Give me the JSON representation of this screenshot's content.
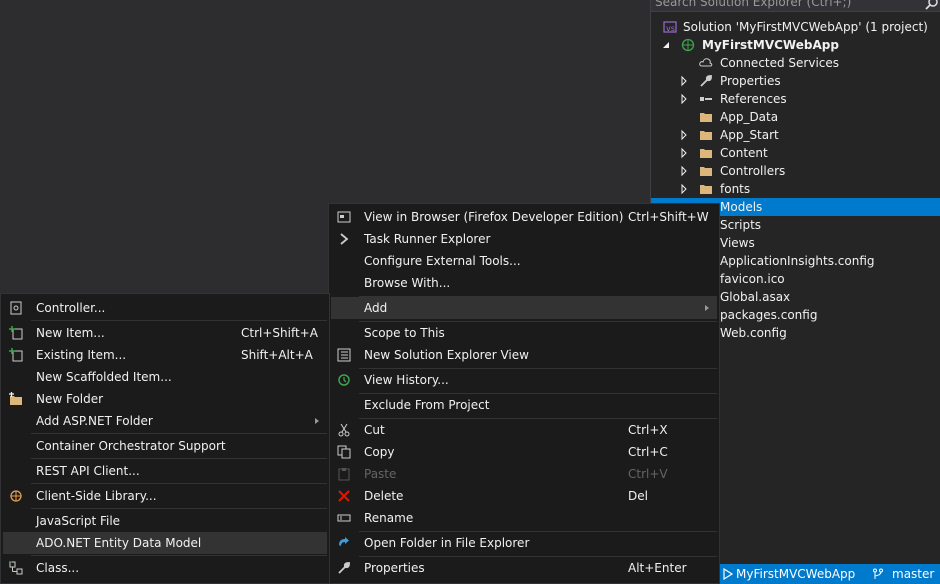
{
  "solution_explorer": {
    "search_placeholder": "Search Solution Explorer (Ctrl+;)",
    "solution_label": "Solution 'MyFirstMVCWebApp' (1 project)",
    "project_label": "MyFirstMVCWebApp",
    "items": [
      {
        "label": "Connected Services",
        "icon": "cloud-icon"
      },
      {
        "label": "Properties",
        "icon": "wrench-icon"
      },
      {
        "label": "References",
        "icon": "references-icon"
      },
      {
        "label": "App_Data",
        "icon": "folder-icon"
      },
      {
        "label": "App_Start",
        "icon": "folder-icon"
      },
      {
        "label": "Content",
        "icon": "folder-icon"
      },
      {
        "label": "Controllers",
        "icon": "folder-icon"
      },
      {
        "label": "fonts",
        "icon": "folder-icon"
      },
      {
        "label": "Models",
        "icon": "folder-icon"
      },
      {
        "label": "Scripts",
        "icon": "folder-icon"
      },
      {
        "label": "Views",
        "icon": "folder-icon"
      },
      {
        "label": "ApplicationInsights.config",
        "icon": "config-file-icon"
      },
      {
        "label": "favicon.ico",
        "icon": "ico-file-icon"
      },
      {
        "label": "Global.asax",
        "icon": "asax-file-icon"
      },
      {
        "label": "packages.config",
        "icon": "config-file-icon"
      },
      {
        "label": "Web.config",
        "icon": "config-file-icon"
      }
    ]
  },
  "context_menu": {
    "view_in_browser": {
      "label": "View in Browser (Firefox Developer Edition)",
      "shortcut": "Ctrl+Shift+W"
    },
    "task_runner": {
      "label": "Task Runner Explorer"
    },
    "configure_tools": {
      "label": "Configure External Tools..."
    },
    "browse_with": {
      "label": "Browse With..."
    },
    "add": {
      "label": "Add"
    },
    "scope_to_this": {
      "label": "Scope to This"
    },
    "new_se_view": {
      "label": "New Solution Explorer View"
    },
    "view_history": {
      "label": "View History..."
    },
    "exclude": {
      "label": "Exclude From Project"
    },
    "cut": {
      "label": "Cut",
      "shortcut": "Ctrl+X"
    },
    "copy": {
      "label": "Copy",
      "shortcut": "Ctrl+C"
    },
    "paste": {
      "label": "Paste",
      "shortcut": "Ctrl+V"
    },
    "delete": {
      "label": "Delete",
      "shortcut": "Del"
    },
    "rename": {
      "label": "Rename"
    },
    "open_folder": {
      "label": "Open Folder in File Explorer"
    },
    "properties": {
      "label": "Properties",
      "shortcut": "Alt+Enter"
    }
  },
  "add_submenu": {
    "controller": {
      "label": "Controller..."
    },
    "new_item": {
      "label": "New Item...",
      "shortcut": "Ctrl+Shift+A"
    },
    "existing_item": {
      "label": "Existing Item...",
      "shortcut": "Shift+Alt+A"
    },
    "new_scaffolded": {
      "label": "New Scaffolded Item..."
    },
    "new_folder": {
      "label": "New Folder"
    },
    "add_aspnet_folder": {
      "label": "Add ASP.NET Folder"
    },
    "container_orchestrator": {
      "label": "Container Orchestrator Support"
    },
    "rest_api": {
      "label": "REST API Client..."
    },
    "client_side_lib": {
      "label": "Client-Side Library..."
    },
    "javascript_file": {
      "label": "JavaScript File"
    },
    "adonet_model": {
      "label": "ADO.NET Entity Data Model"
    },
    "class": {
      "label": "Class..."
    }
  },
  "status_bar": {
    "project": "MyFirstMVCWebApp",
    "branch": "master"
  },
  "colors": {
    "accent": "#007acc",
    "folder": "#dcb67a",
    "menu_bg": "#1b1b1c",
    "editor_bg": "#2d2d30"
  }
}
